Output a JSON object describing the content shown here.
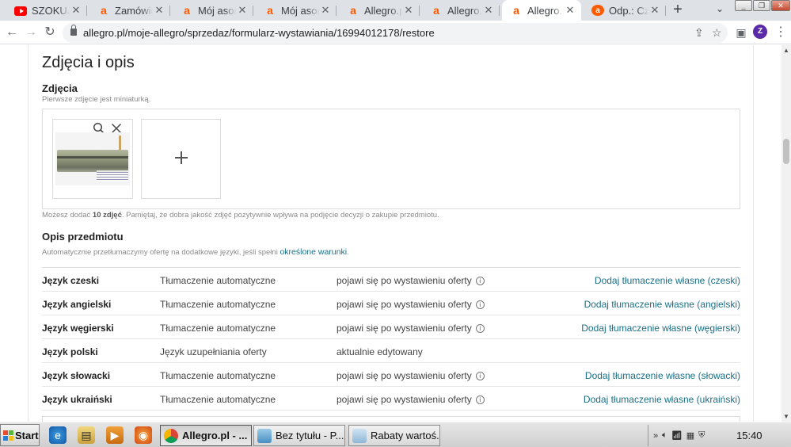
{
  "browser": {
    "tabs": [
      {
        "title": "SZOKUJĄC",
        "icon": "youtube-icon"
      },
      {
        "title": "Zamówieni",
        "icon": "allegro-icon"
      },
      {
        "title": "Mój asorty",
        "icon": "allegro-icon"
      },
      {
        "title": "Mój asorty",
        "icon": "allegro-icon"
      },
      {
        "title": "Allegro.pl",
        "icon": "allegro-icon"
      },
      {
        "title": "Allegro.pl",
        "icon": "allegro-icon"
      },
      {
        "title": "Allegro.pl",
        "icon": "allegro-icon",
        "active": true
      },
      {
        "title": "Odp.: Czy",
        "icon": "allegro-circle-icon"
      }
    ],
    "url": "allegro.pl/moje-allegro/sprzedaz/formularz-wystawiania/16994012178/restore",
    "profile_initial": "Z"
  },
  "page": {
    "section_title": "Zdjęcia i opis",
    "photos": {
      "heading": "Zdjęcia",
      "hint": "Pierwsze zdjęcie jest miniaturką.",
      "footer_pre": "Możesz dodać ",
      "footer_bold": "10 zdjęć",
      "footer_post": ". Pamiętaj, że dobra jakość zdjęć pozytywnie wpływa na podjęcie decyzji o zakupie przedmiotu."
    },
    "description": {
      "heading": "Opis przedmiotu",
      "hint_pre": "Automatycznie przetłumaczymy ofertę na dodatkowe języki, jeśli spełni ",
      "hint_link": "określone warunki",
      "hint_post": "."
    },
    "languages": [
      {
        "lang": "Język czeski",
        "mode": "Tłumaczenie automatyczne",
        "status": "pojawi się po wystawieniu oferty",
        "info": true,
        "action": "Dodaj tłumaczenie własne (czeski)"
      },
      {
        "lang": "Język angielski",
        "mode": "Tłumaczenie automatyczne",
        "status": "pojawi się po wystawieniu oferty",
        "info": true,
        "action": "Dodaj tłumaczenie własne (angielski)"
      },
      {
        "lang": "Język węgierski",
        "mode": "Tłumaczenie automatyczne",
        "status": "pojawi się po wystawieniu oferty",
        "info": true,
        "action": "Dodaj tłumaczenie własne (węgierski)"
      },
      {
        "lang": "Język polski",
        "mode": "Język uzupełniania oferty",
        "status": "aktualnie edytowany",
        "info": false,
        "action": ""
      },
      {
        "lang": "Język słowacki",
        "mode": "Tłumaczenie automatyczne",
        "status": "pojawi się po wystawieniu oferty",
        "info": true,
        "action": "Dodaj tłumaczenie własne (słowacki)"
      },
      {
        "lang": "Język ukraiński",
        "mode": "Tłumaczenie automatyczne",
        "status": "pojawi się po wystawieniu oferty",
        "info": true,
        "action": "Dodaj tłumaczenie własne (ukraiński)"
      }
    ]
  },
  "taskbar": {
    "start_label": "Start",
    "tasks": [
      {
        "label": "Allegro.pl - ...",
        "icon": "chrome-icon",
        "active": true
      },
      {
        "label": "Bez tytułu - P...",
        "icon": "paint-icon",
        "active": false
      },
      {
        "label": "Rabaty wartoś...",
        "icon": "notepad-icon",
        "active": false
      }
    ],
    "clock": "15:40"
  },
  "colors": {
    "link": "#1a6f86",
    "allegro_orange": "#ff5a00",
    "chrome_tabstrip": "#dee1e6"
  }
}
